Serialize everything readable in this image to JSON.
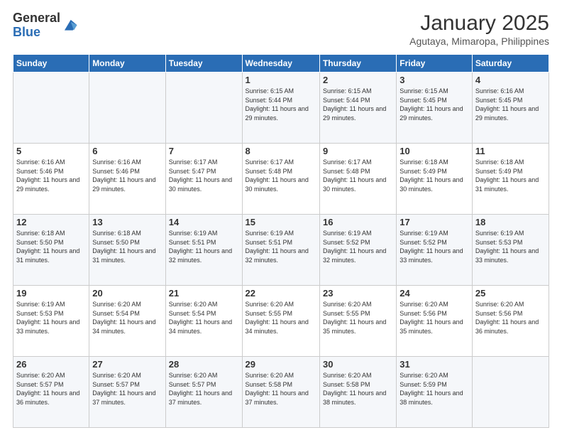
{
  "logo": {
    "general": "General",
    "blue": "Blue"
  },
  "header": {
    "month_year": "January 2025",
    "location": "Agutaya, Mimaropa, Philippines"
  },
  "weekdays": [
    "Sunday",
    "Monday",
    "Tuesday",
    "Wednesday",
    "Thursday",
    "Friday",
    "Saturday"
  ],
  "weeks": [
    [
      {
        "day": "",
        "sunrise": "",
        "sunset": "",
        "daylight": ""
      },
      {
        "day": "",
        "sunrise": "",
        "sunset": "",
        "daylight": ""
      },
      {
        "day": "",
        "sunrise": "",
        "sunset": "",
        "daylight": ""
      },
      {
        "day": "1",
        "sunrise": "Sunrise: 6:15 AM",
        "sunset": "Sunset: 5:44 PM",
        "daylight": "Daylight: 11 hours and 29 minutes."
      },
      {
        "day": "2",
        "sunrise": "Sunrise: 6:15 AM",
        "sunset": "Sunset: 5:44 PM",
        "daylight": "Daylight: 11 hours and 29 minutes."
      },
      {
        "day": "3",
        "sunrise": "Sunrise: 6:15 AM",
        "sunset": "Sunset: 5:45 PM",
        "daylight": "Daylight: 11 hours and 29 minutes."
      },
      {
        "day": "4",
        "sunrise": "Sunrise: 6:16 AM",
        "sunset": "Sunset: 5:45 PM",
        "daylight": "Daylight: 11 hours and 29 minutes."
      }
    ],
    [
      {
        "day": "5",
        "sunrise": "Sunrise: 6:16 AM",
        "sunset": "Sunset: 5:46 PM",
        "daylight": "Daylight: 11 hours and 29 minutes."
      },
      {
        "day": "6",
        "sunrise": "Sunrise: 6:16 AM",
        "sunset": "Sunset: 5:46 PM",
        "daylight": "Daylight: 11 hours and 29 minutes."
      },
      {
        "day": "7",
        "sunrise": "Sunrise: 6:17 AM",
        "sunset": "Sunset: 5:47 PM",
        "daylight": "Daylight: 11 hours and 30 minutes."
      },
      {
        "day": "8",
        "sunrise": "Sunrise: 6:17 AM",
        "sunset": "Sunset: 5:48 PM",
        "daylight": "Daylight: 11 hours and 30 minutes."
      },
      {
        "day": "9",
        "sunrise": "Sunrise: 6:17 AM",
        "sunset": "Sunset: 5:48 PM",
        "daylight": "Daylight: 11 hours and 30 minutes."
      },
      {
        "day": "10",
        "sunrise": "Sunrise: 6:18 AM",
        "sunset": "Sunset: 5:49 PM",
        "daylight": "Daylight: 11 hours and 30 minutes."
      },
      {
        "day": "11",
        "sunrise": "Sunrise: 6:18 AM",
        "sunset": "Sunset: 5:49 PM",
        "daylight": "Daylight: 11 hours and 31 minutes."
      }
    ],
    [
      {
        "day": "12",
        "sunrise": "Sunrise: 6:18 AM",
        "sunset": "Sunset: 5:50 PM",
        "daylight": "Daylight: 11 hours and 31 minutes."
      },
      {
        "day": "13",
        "sunrise": "Sunrise: 6:18 AM",
        "sunset": "Sunset: 5:50 PM",
        "daylight": "Daylight: 11 hours and 31 minutes."
      },
      {
        "day": "14",
        "sunrise": "Sunrise: 6:19 AM",
        "sunset": "Sunset: 5:51 PM",
        "daylight": "Daylight: 11 hours and 32 minutes."
      },
      {
        "day": "15",
        "sunrise": "Sunrise: 6:19 AM",
        "sunset": "Sunset: 5:51 PM",
        "daylight": "Daylight: 11 hours and 32 minutes."
      },
      {
        "day": "16",
        "sunrise": "Sunrise: 6:19 AM",
        "sunset": "Sunset: 5:52 PM",
        "daylight": "Daylight: 11 hours and 32 minutes."
      },
      {
        "day": "17",
        "sunrise": "Sunrise: 6:19 AM",
        "sunset": "Sunset: 5:52 PM",
        "daylight": "Daylight: 11 hours and 33 minutes."
      },
      {
        "day": "18",
        "sunrise": "Sunrise: 6:19 AM",
        "sunset": "Sunset: 5:53 PM",
        "daylight": "Daylight: 11 hours and 33 minutes."
      }
    ],
    [
      {
        "day": "19",
        "sunrise": "Sunrise: 6:19 AM",
        "sunset": "Sunset: 5:53 PM",
        "daylight": "Daylight: 11 hours and 33 minutes."
      },
      {
        "day": "20",
        "sunrise": "Sunrise: 6:20 AM",
        "sunset": "Sunset: 5:54 PM",
        "daylight": "Daylight: 11 hours and 34 minutes."
      },
      {
        "day": "21",
        "sunrise": "Sunrise: 6:20 AM",
        "sunset": "Sunset: 5:54 PM",
        "daylight": "Daylight: 11 hours and 34 minutes."
      },
      {
        "day": "22",
        "sunrise": "Sunrise: 6:20 AM",
        "sunset": "Sunset: 5:55 PM",
        "daylight": "Daylight: 11 hours and 34 minutes."
      },
      {
        "day": "23",
        "sunrise": "Sunrise: 6:20 AM",
        "sunset": "Sunset: 5:55 PM",
        "daylight": "Daylight: 11 hours and 35 minutes."
      },
      {
        "day": "24",
        "sunrise": "Sunrise: 6:20 AM",
        "sunset": "Sunset: 5:56 PM",
        "daylight": "Daylight: 11 hours and 35 minutes."
      },
      {
        "day": "25",
        "sunrise": "Sunrise: 6:20 AM",
        "sunset": "Sunset: 5:56 PM",
        "daylight": "Daylight: 11 hours and 36 minutes."
      }
    ],
    [
      {
        "day": "26",
        "sunrise": "Sunrise: 6:20 AM",
        "sunset": "Sunset: 5:57 PM",
        "daylight": "Daylight: 11 hours and 36 minutes."
      },
      {
        "day": "27",
        "sunrise": "Sunrise: 6:20 AM",
        "sunset": "Sunset: 5:57 PM",
        "daylight": "Daylight: 11 hours and 37 minutes."
      },
      {
        "day": "28",
        "sunrise": "Sunrise: 6:20 AM",
        "sunset": "Sunset: 5:57 PM",
        "daylight": "Daylight: 11 hours and 37 minutes."
      },
      {
        "day": "29",
        "sunrise": "Sunrise: 6:20 AM",
        "sunset": "Sunset: 5:58 PM",
        "daylight": "Daylight: 11 hours and 37 minutes."
      },
      {
        "day": "30",
        "sunrise": "Sunrise: 6:20 AM",
        "sunset": "Sunset: 5:58 PM",
        "daylight": "Daylight: 11 hours and 38 minutes."
      },
      {
        "day": "31",
        "sunrise": "Sunrise: 6:20 AM",
        "sunset": "Sunset: 5:59 PM",
        "daylight": "Daylight: 11 hours and 38 minutes."
      },
      {
        "day": "",
        "sunrise": "",
        "sunset": "",
        "daylight": ""
      }
    ]
  ]
}
